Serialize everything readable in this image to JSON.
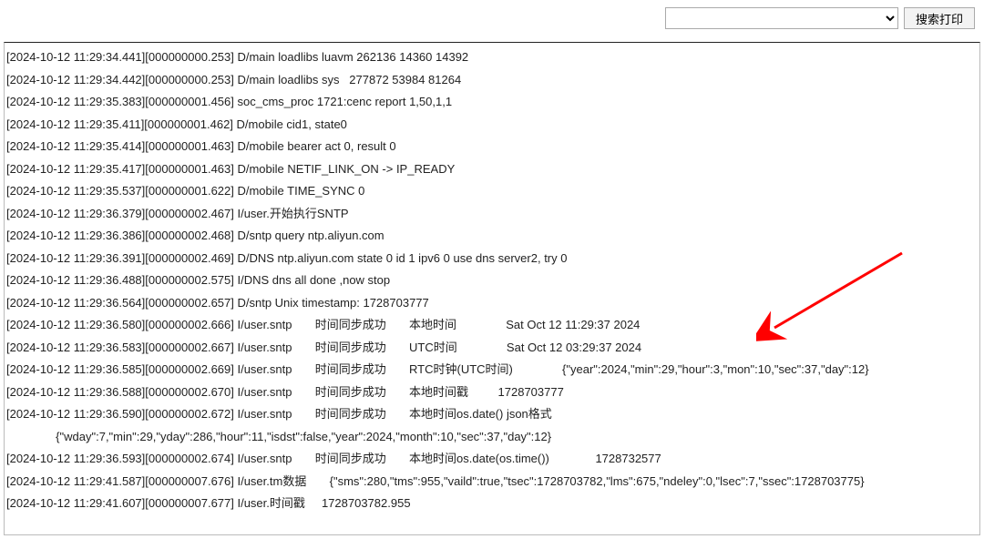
{
  "toolbar": {
    "search_value": "",
    "search_placeholder": "",
    "search_button_label": "搜索打印"
  },
  "logs": [
    "[2024-10-12 11:29:34.441][000000000.253] D/main loadlibs luavm 262136 14360 14392",
    "[2024-10-12 11:29:34.442][000000000.253] D/main loadlibs sys   277872 53984 81264",
    "[2024-10-12 11:29:35.383][000000001.456] soc_cms_proc 1721:cenc report 1,50,1,1",
    "[2024-10-12 11:29:35.411][000000001.462] D/mobile cid1, state0",
    "[2024-10-12 11:29:35.414][000000001.463] D/mobile bearer act 0, result 0",
    "[2024-10-12 11:29:35.417][000000001.463] D/mobile NETIF_LINK_ON -> IP_READY",
    "[2024-10-12 11:29:35.537][000000001.622] D/mobile TIME_SYNC 0",
    "[2024-10-12 11:29:36.379][000000002.467] I/user.开始执行SNTP",
    "[2024-10-12 11:29:36.386][000000002.468] D/sntp query ntp.aliyun.com",
    "[2024-10-12 11:29:36.391][000000002.469] D/DNS ntp.aliyun.com state 0 id 1 ipv6 0 use dns server2, try 0",
    "[2024-10-12 11:29:36.488][000000002.575] I/DNS dns all done ,now stop",
    "[2024-10-12 11:29:36.564][000000002.657] D/sntp Unix timestamp: 1728703777",
    "[2024-10-12 11:29:36.580][000000002.666] I/user.sntp       时间同步成功       本地时间               Sat Oct 12 11:29:37 2024",
    "[2024-10-12 11:29:36.583][000000002.667] I/user.sntp       时间同步成功       UTC时间               Sat Oct 12 03:29:37 2024",
    "[2024-10-12 11:29:36.585][000000002.669] I/user.sntp       时间同步成功       RTC时钟(UTC时间)               {\"year\":2024,\"min\":29,\"hour\":3,\"mon\":10,\"sec\":37,\"day\":12}",
    "[2024-10-12 11:29:36.588][000000002.670] I/user.sntp       时间同步成功       本地时间戳         1728703777",
    "[2024-10-12 11:29:36.590][000000002.672] I/user.sntp       时间同步成功       本地时间os.date() json格式",
    "               {\"wday\":7,\"min\":29,\"yday\":286,\"hour\":11,\"isdst\":false,\"year\":2024,\"month\":10,\"sec\":37,\"day\":12}",
    "[2024-10-12 11:29:36.593][000000002.674] I/user.sntp       时间同步成功       本地时间os.date(os.time())              1728732577",
    "[2024-10-12 11:29:41.587][000000007.676] I/user.tm数据       {\"sms\":280,\"tms\":955,\"vaild\":true,\"tsec\":1728703782,\"lms\":675,\"ndeley\":0,\"lsec\":7,\"ssec\":1728703775}",
    "[2024-10-12 11:29:41.607][000000007.677] I/user.时间戳     1728703782.955"
  ],
  "annotation": {
    "arrow_color": "#ff0000"
  }
}
